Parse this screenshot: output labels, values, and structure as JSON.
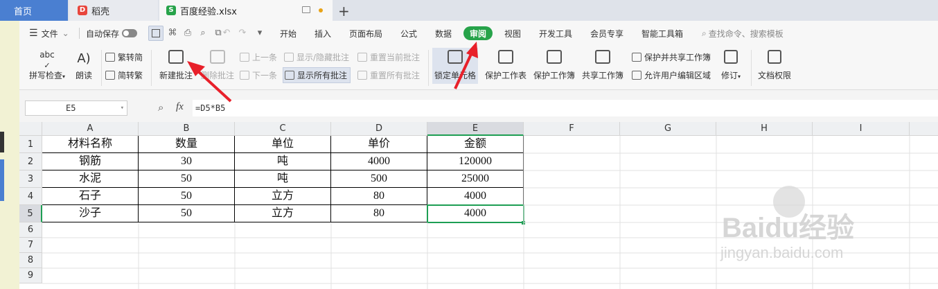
{
  "tabs": {
    "home": "首页",
    "daoke": "稻壳",
    "file": "百度经验.xlsx"
  },
  "menu": {
    "file": "文件",
    "autosave": "自动保存",
    "tabs": [
      "开始",
      "插入",
      "页面布局",
      "公式",
      "数据",
      "审阅",
      "视图",
      "开发工具",
      "会员专享",
      "智能工具箱"
    ],
    "search_placeholder": "查找命令、搜索模板"
  },
  "ribbon": {
    "spellcheck": "拼写检查",
    "read": "朗读",
    "trad": "繁转简",
    "simp": "简转繁",
    "new_comment": "新建批注",
    "delete_comment": "删除批注",
    "prev": "上一条",
    "next": "下一条",
    "show_hide": "显示/隐藏批注",
    "show_all": "显示所有批注",
    "reset_current": "重置当前批注",
    "reset_all": "重置所有批注",
    "lock_cell": "锁定单元格",
    "protect_sheet": "保护工作表",
    "protect_book": "保护工作簿",
    "share_book": "共享工作簿",
    "protect_share": "保护并共享工作簿",
    "allow_edit": "允许用户编辑区域",
    "revise": "修订",
    "doc_rights": "文档权限"
  },
  "formula_bar": {
    "cell_ref": "E5",
    "fx": "fx",
    "formula": "=D5*B5"
  },
  "sheet": {
    "columns": [
      "A",
      "B",
      "C",
      "D",
      "E",
      "F",
      "G",
      "H",
      "I"
    ],
    "rows": [
      "1",
      "2",
      "3",
      "4",
      "5",
      "6",
      "7",
      "8",
      "9"
    ],
    "data": [
      [
        "材料名称",
        "数量",
        "单位",
        "单价",
        "金额"
      ],
      [
        "钢筋",
        "30",
        "吨",
        "4000",
        "120000"
      ],
      [
        "水泥",
        "50",
        "吨",
        "500",
        "25000"
      ],
      [
        "石子",
        "50",
        "立方",
        "80",
        "4000"
      ],
      [
        "沙子",
        "50",
        "立方",
        "80",
        "4000"
      ]
    ]
  },
  "watermark": {
    "brand": "Baidu经验",
    "url": "jingyan.baidu.com"
  },
  "colors": {
    "accent": "#27a34a",
    "arrow": "#e8202a",
    "home_tab": "#4a7fd1"
  }
}
